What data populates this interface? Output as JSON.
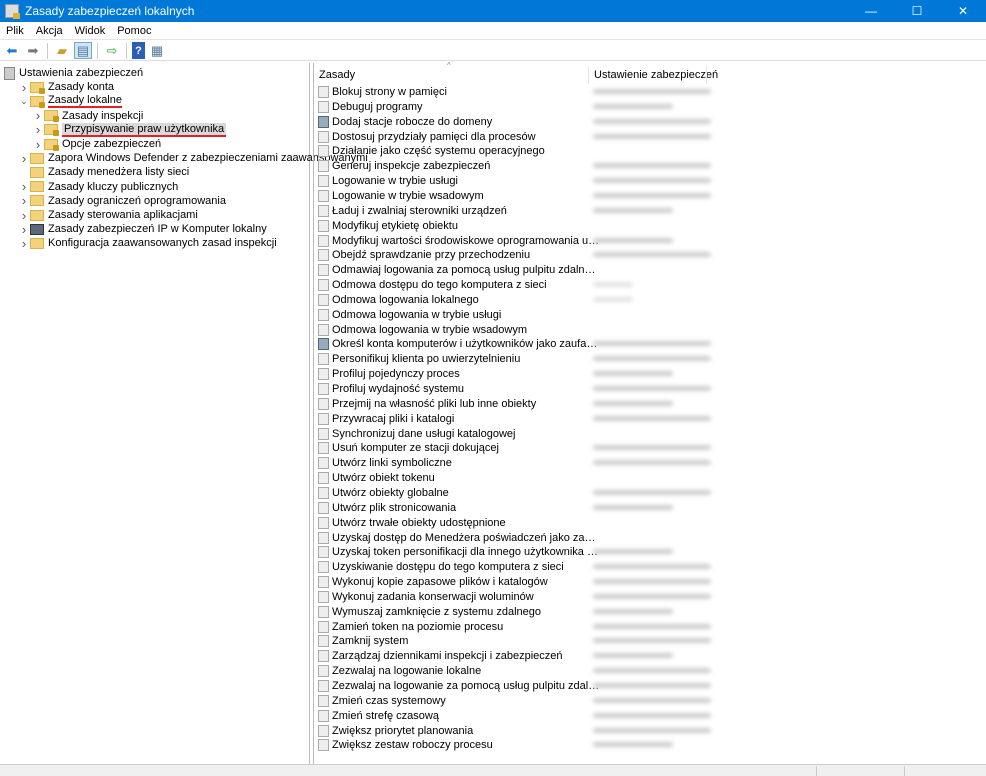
{
  "window": {
    "title": "Zasady zabezpieczeń lokalnych",
    "minimize": "—",
    "maximize": "☐",
    "close": "✕"
  },
  "menu": [
    "Plik",
    "Akcja",
    "Widok",
    "Pomoc"
  ],
  "toolbar": [
    "back-icon",
    "forward-icon",
    "up-folder-icon",
    "show-hide-tree-icon",
    "export-list-icon",
    "help-icon",
    "properties-icon"
  ],
  "tree": [
    {
      "label": "Ustawienia zabezpieczeń",
      "level": 0,
      "icon": "root",
      "chev": ""
    },
    {
      "label": "Zasady konta",
      "level": 1,
      "icon": "lock",
      "chev": ">"
    },
    {
      "label": "Zasady lokalne",
      "level": 1,
      "icon": "lock",
      "chev": "v",
      "underline": true
    },
    {
      "label": "Zasady inspekcji",
      "level": 2,
      "icon": "lock",
      "chev": ">"
    },
    {
      "label": "Przypisywanie praw użytkownika",
      "level": 2,
      "icon": "lock",
      "chev": ">",
      "underline": true,
      "selected": true
    },
    {
      "label": "Opcje zabezpieczeń",
      "level": 2,
      "icon": "lock",
      "chev": ">"
    },
    {
      "label": "Zapora Windows Defender z zabezpieczeniami zaawansowanymi",
      "level": 1,
      "icon": "folder",
      "chev": ">"
    },
    {
      "label": "Zasady menedżera listy sieci",
      "level": 1,
      "icon": "folder",
      "chev": ""
    },
    {
      "label": "Zasady kluczy publicznych",
      "level": 1,
      "icon": "folder",
      "chev": ">"
    },
    {
      "label": "Zasady ograniczeń oprogramowania",
      "level": 1,
      "icon": "folder",
      "chev": ">"
    },
    {
      "label": "Zasady sterowania aplikacjami",
      "level": 1,
      "icon": "folder",
      "chev": ">"
    },
    {
      "label": "Zasady zabezpieczeń IP w Komputer lokalny",
      "level": 1,
      "icon": "ipsec",
      "chev": ">"
    },
    {
      "label": "Konfiguracja zaawansowanych zasad inspekcji",
      "level": 1,
      "icon": "folder",
      "chev": ">"
    }
  ],
  "list": {
    "columns": [
      "Zasady",
      "Ustawienie zabezpieczeń"
    ],
    "rows": [
      {
        "name": "Blokuj strony w pamięci",
        "setting": "long"
      },
      {
        "name": "Debuguj programy",
        "setting": "short"
      },
      {
        "name": "Dodaj stacje robocze do domeny",
        "setting": "long",
        "alt": true
      },
      {
        "name": "Dostosuj przydziały pamięci dla procesów",
        "setting": "long"
      },
      {
        "name": "Działanie jako część systemu operacyjnego",
        "setting": ""
      },
      {
        "name": "Generuj inspekcje zabezpieczeń",
        "setting": "long"
      },
      {
        "name": "Logowanie w trybie usługi",
        "setting": "long"
      },
      {
        "name": "Logowanie w trybie wsadowym",
        "setting": "long"
      },
      {
        "name": "Ładuj i zwalniaj sterowniki urządzeń",
        "setting": "short"
      },
      {
        "name": "Modyfikuj etykietę obiektu",
        "setting": ""
      },
      {
        "name": "Modyfikuj wartości środowiskowe oprogramowania układowego",
        "setting": "short"
      },
      {
        "name": "Obejdź sprawdzanie przy przechodzeniu",
        "setting": "long"
      },
      {
        "name": "Odmawiaj logowania za pomocą usług pulpitu zdalnego",
        "setting": ""
      },
      {
        "name": "Odmowa dostępu do tego komputera z sieci",
        "setting": "faint"
      },
      {
        "name": "Odmowa logowania lokalnego",
        "setting": "faint"
      },
      {
        "name": "Odmowa logowania w trybie usługi",
        "setting": ""
      },
      {
        "name": "Odmowa logowania w trybie wsadowym",
        "setting": ""
      },
      {
        "name": "Określ konta komputerów i użytkowników jako zaufane w kontekście delegowania",
        "setting": "long",
        "alt": true
      },
      {
        "name": "Personifikuj klienta po uwierzytelnieniu",
        "setting": "long"
      },
      {
        "name": "Profiluj pojedynczy proces",
        "setting": "short"
      },
      {
        "name": "Profiluj wydajność systemu",
        "setting": "long"
      },
      {
        "name": "Przejmij na własność pliki lub inne obiekty",
        "setting": "short"
      },
      {
        "name": "Przywracaj pliki i katalogi",
        "setting": "long"
      },
      {
        "name": "Synchronizuj dane usługi katalogowej",
        "setting": ""
      },
      {
        "name": "Usuń komputer ze stacji dokującej",
        "setting": "long"
      },
      {
        "name": "Utwórz linki symboliczne",
        "setting": "long"
      },
      {
        "name": "Utwórz obiekt tokenu",
        "setting": ""
      },
      {
        "name": "Utwórz obiekty globalne",
        "setting": "long"
      },
      {
        "name": "Utwórz plik stronicowania",
        "setting": "short"
      },
      {
        "name": "Utwórz trwałe obiekty udostępnione",
        "setting": ""
      },
      {
        "name": "Uzyskaj dostęp do Menedżera poświadczeń jako zaufany obiekt wywołujący",
        "setting": ""
      },
      {
        "name": "Uzyskaj token personifikacji dla innego użytkownika w ramach tej samej sesji",
        "setting": "short"
      },
      {
        "name": "Uzyskiwanie dostępu do tego komputera z sieci",
        "setting": "long"
      },
      {
        "name": "Wykonuj kopie zapasowe plików i katalogów",
        "setting": "long"
      },
      {
        "name": "Wykonuj zadania konserwacji woluminów",
        "setting": "long"
      },
      {
        "name": "Wymuszaj zamknięcie z systemu zdalnego",
        "setting": "short"
      },
      {
        "name": "Zamień token na poziomie procesu",
        "setting": "long"
      },
      {
        "name": "Zamknij system",
        "setting": "long"
      },
      {
        "name": "Zarządzaj dziennikami inspekcji i zabezpieczeń",
        "setting": "short"
      },
      {
        "name": "Zezwalaj na logowanie lokalne",
        "setting": "long"
      },
      {
        "name": "Zezwalaj na logowanie za pomocą usług pulpitu zdalnego",
        "setting": "long"
      },
      {
        "name": "Zmień czas systemowy",
        "setting": "long"
      },
      {
        "name": "Zmień strefę czasową",
        "setting": "long"
      },
      {
        "name": "Zwiększ priorytet planowania",
        "setting": "long"
      },
      {
        "name": "Zwiększ zestaw roboczy procesu",
        "setting": "short"
      }
    ]
  }
}
